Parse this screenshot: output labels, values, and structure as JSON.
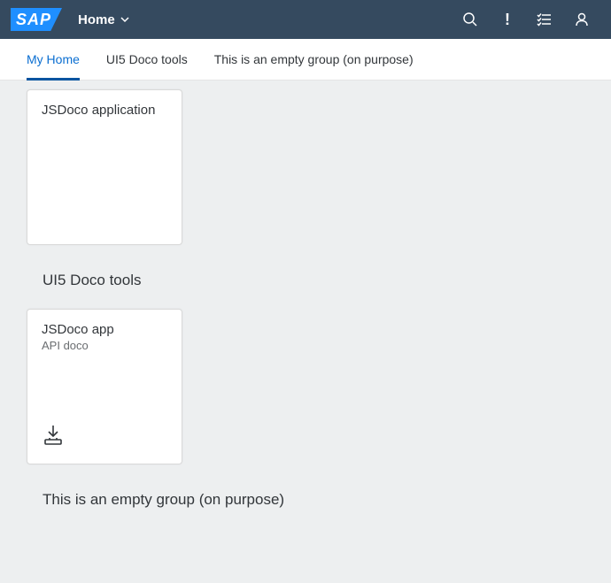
{
  "header": {
    "logo_text": "SAP",
    "title": "Home",
    "icons": [
      "search-icon",
      "notification-icon",
      "tasks-icon",
      "user-icon"
    ]
  },
  "anchor": {
    "items": [
      {
        "label": "My Home",
        "selected": true
      },
      {
        "label": "UI5 Doco tools",
        "selected": false
      },
      {
        "label": "This is an empty group (on purpose)",
        "selected": false
      }
    ]
  },
  "groups": {
    "g1_tile_title": "JSDoco application",
    "g2_title": "UI5 Doco tools",
    "g2_tile_title": "JSDoco app",
    "g2_tile_subtitle": "API doco",
    "g3_title": "This is an empty group (on purpose)"
  }
}
